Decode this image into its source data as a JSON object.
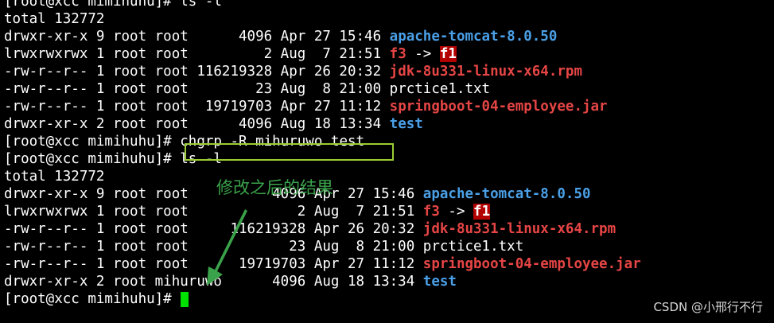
{
  "terminal": {
    "prompt": "[root@xcc mimihuhu]#",
    "cmd1": " ls -l",
    "total1": "total 132772",
    "listing1": [
      {
        "perm": "drwxr-xr-x 9 root root      4096 Apr 27 15:46 ",
        "name": "apache-tomcat-8.0.50",
        "type": "dir"
      },
      {
        "perm": "lrwxrwxrwx 1 root root         2 Aug  7 21:51 ",
        "name": "f3",
        "type": "link",
        "arrow": " -> ",
        "target": "f1"
      },
      {
        "perm": "-rw-r--r-- 1 root root 116219328 Apr 26 20:32 ",
        "name": "jdk-8u331-linux-x64.rpm",
        "type": "rpm"
      },
      {
        "perm": "-rw-r--r-- 1 root root        23 Aug  8 21:00 ",
        "name": "prctice1.txt",
        "type": "file"
      },
      {
        "perm": "-rw-r--r-- 1 root root  19719703 Apr 27 11:12 ",
        "name": "springboot-04-employee.jar",
        "type": "jar"
      },
      {
        "perm": "drwxr-xr-x 2 root root      4096 Aug 18 13:34 ",
        "name": "test",
        "type": "dir"
      }
    ],
    "cmd2": "chgrp -R mihuruwo test",
    "cmd3": " ls -l",
    "total2": "total 132772",
    "listing2": [
      {
        "perm": "drwxr-xr-x 9 root root          4096 Apr 27 15:46 ",
        "name": "apache-tomcat-8.0.50",
        "type": "dir"
      },
      {
        "perm": "lrwxrwxrwx 1 root root             2 Aug  7 21:51 ",
        "name": "f3",
        "type": "link",
        "arrow": " -> ",
        "target": "f1"
      },
      {
        "perm": "-rw-r--r-- 1 root root     116219328 Apr 26 20:32 ",
        "name": "jdk-8u331-linux-x64.rpm",
        "type": "rpm"
      },
      {
        "perm": "-rw-r--r-- 1 root root            23 Aug  8 21:00 ",
        "name": "prctice1.txt",
        "type": "file"
      },
      {
        "perm": "-rw-r--r-- 1 root root      19719703 Apr 27 11:12 ",
        "name": "springboot-04-employee.jar",
        "type": "jar"
      },
      {
        "perm": "drwxr-xr-x 2 root mihuruwo      4096 Aug 18 13:34 ",
        "name": "test",
        "type": "dir"
      }
    ]
  },
  "annotation": "修改之后的结果",
  "watermark": "CSDN @小邢行不行",
  "colors": {
    "dir": "#4a9fe6",
    "red": "#e64545",
    "highlight_box": "#9acd32",
    "annotation": "#3aa24a",
    "cursor": "#00e000"
  }
}
